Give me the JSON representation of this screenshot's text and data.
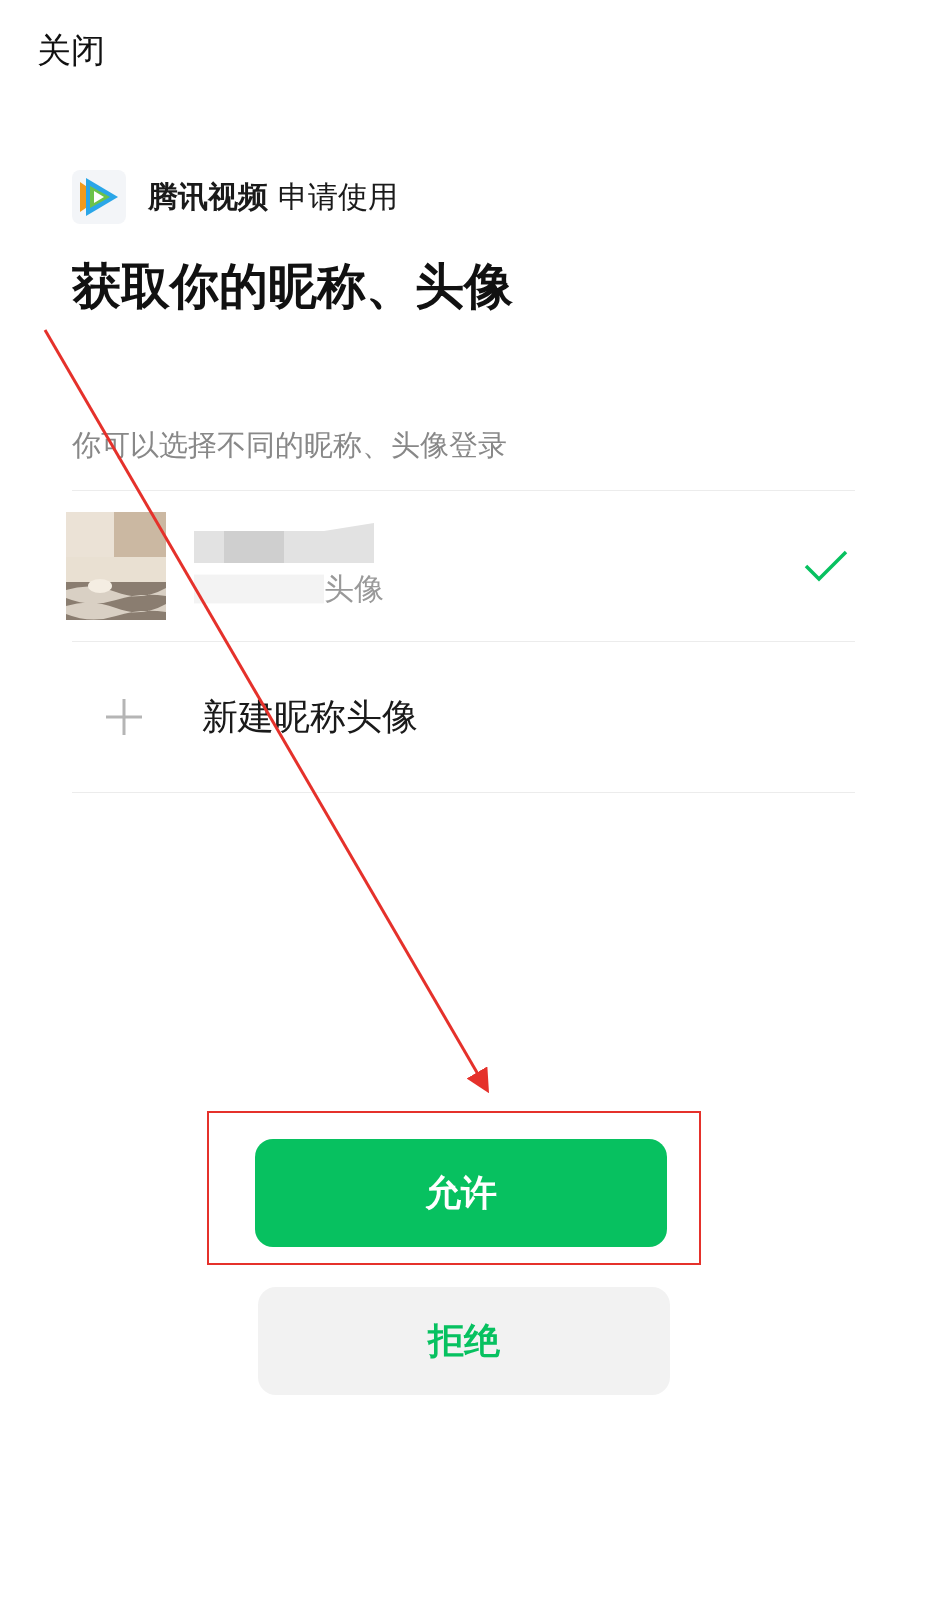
{
  "close": "关闭",
  "app": {
    "name": "腾讯视频",
    "action": "申请使用"
  },
  "heading": "获取你的昵称、头像",
  "hint": "你可以选择不同的昵称、头像登录",
  "accounts": [
    {
      "kind": "existing",
      "subtitle": "头像",
      "selected": true
    },
    {
      "kind": "new",
      "label": "新建昵称头像",
      "selected": false
    }
  ],
  "buttons": [
    {
      "kind": "primary",
      "label": "允许"
    },
    {
      "kind": "secondary",
      "label": "拒绝"
    }
  ]
}
